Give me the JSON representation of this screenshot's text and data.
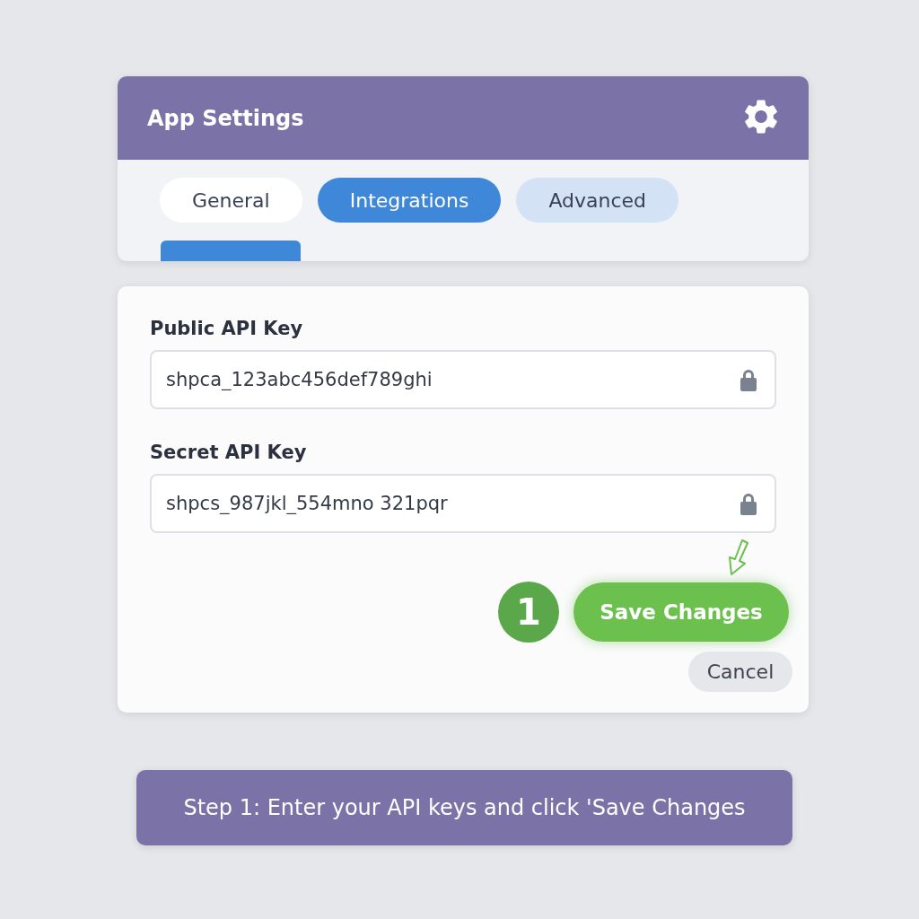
{
  "window": {
    "title": "App Settings"
  },
  "tabs": [
    {
      "label": "General",
      "selected": false,
      "hover": false
    },
    {
      "label": "Integrations",
      "selected": true,
      "hover": false
    },
    {
      "label": "Advanced",
      "selected": false,
      "hover": true
    }
  ],
  "fields": [
    {
      "label": "Public API Key",
      "value": "shpca_123abc456def789ghi",
      "locked": true
    },
    {
      "label": "Secret API Key",
      "value": "shpcs_987jkl_554mno 321pqr",
      "locked": true
    }
  ],
  "step_badge": "1",
  "buttons": [
    {
      "kind": "primary",
      "label": "Save Changes"
    },
    {
      "kind": "secondary",
      "label": "Cancel"
    }
  ],
  "instruction": "Step 1: Enter your API keys and click 'Save Changes"
}
